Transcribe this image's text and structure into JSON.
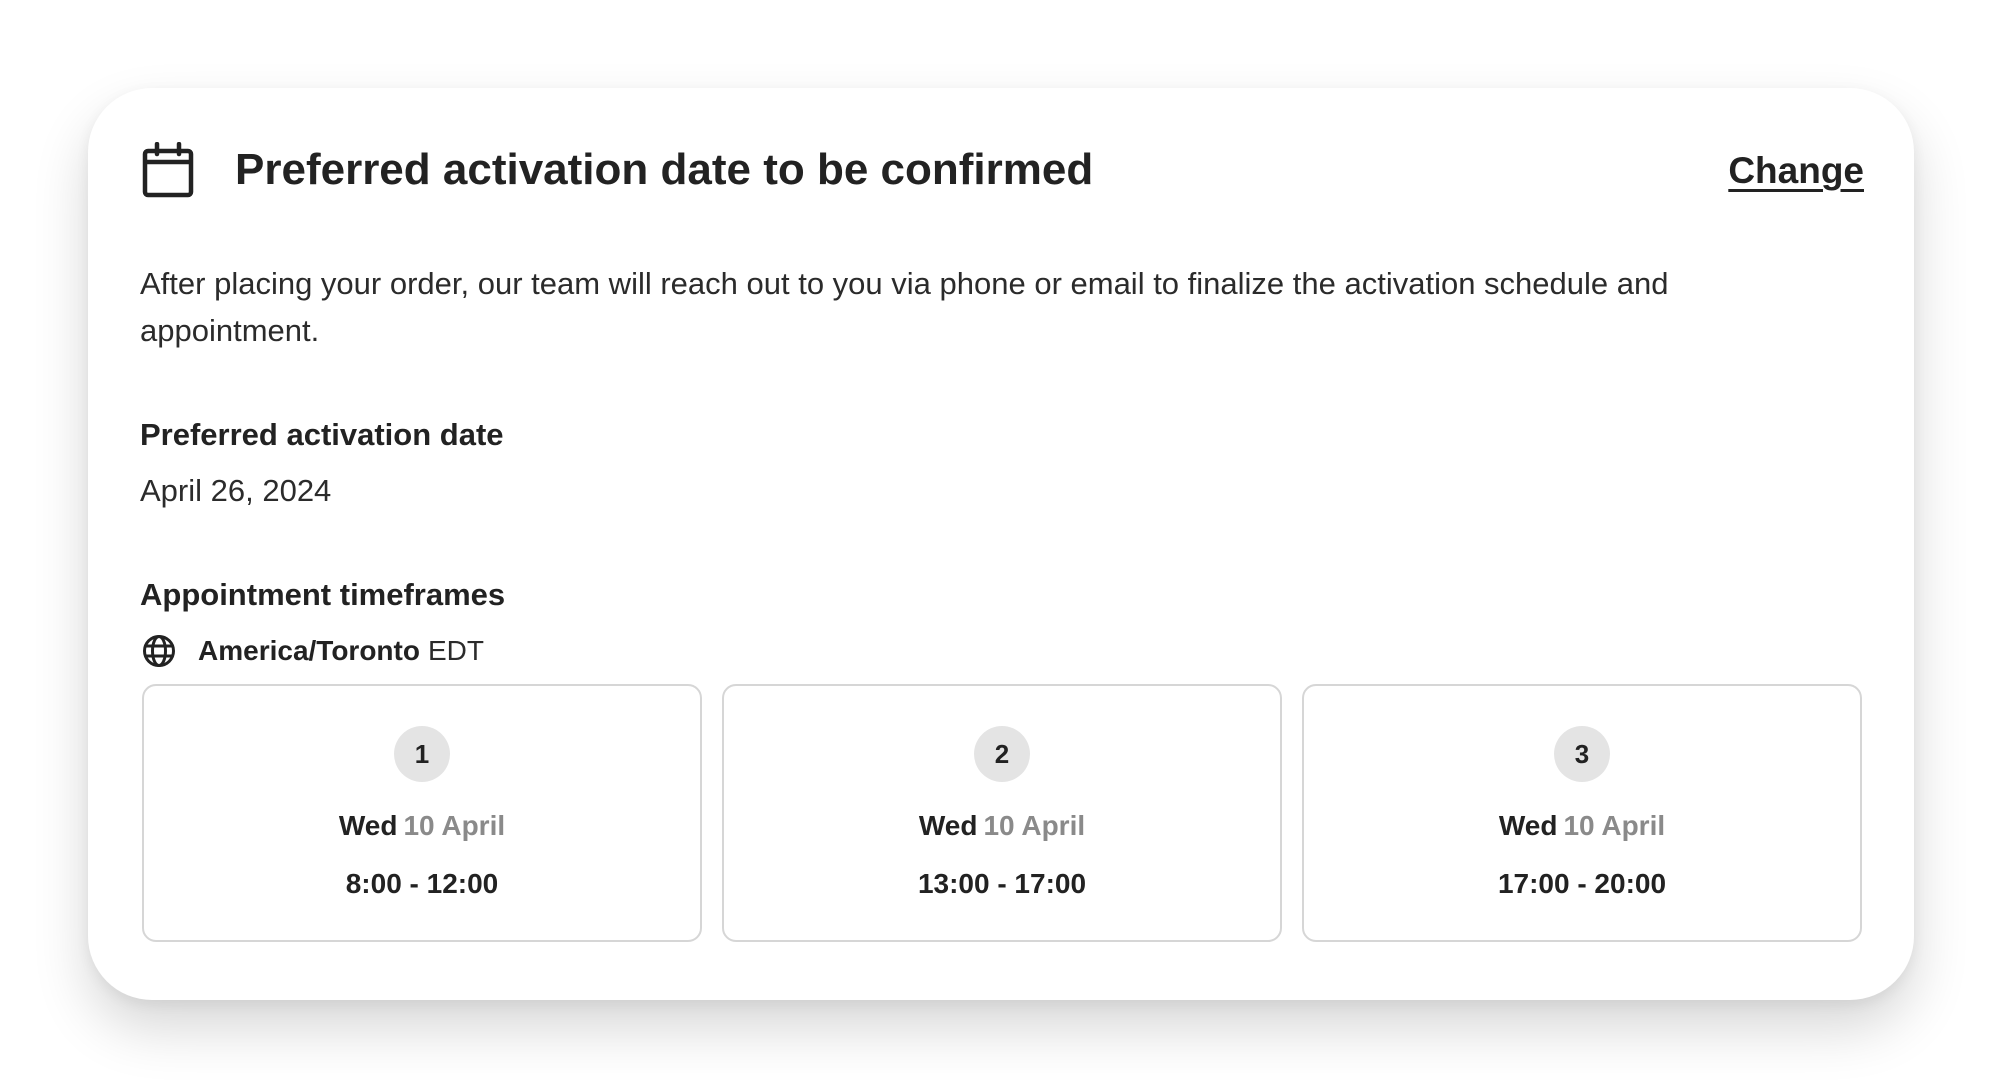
{
  "card": {
    "title": "Preferred activation date to be confirmed",
    "change_label": "Change",
    "calendar_icon": "calendar-icon",
    "description": "After placing your order, our team will reach out to you via phone or email to finalize the activation schedule and appointment."
  },
  "preferred_date": {
    "label": "Preferred activation date",
    "value": "April 26, 2024"
  },
  "appointments": {
    "label": "Appointment timeframes",
    "timezone_icon": "globe-icon",
    "timezone_name": "America/Toronto",
    "timezone_abbr": "EDT",
    "slots": [
      {
        "number": "1",
        "day": "Wed",
        "date": "10 April",
        "time": "8:00 - 12:00"
      },
      {
        "number": "2",
        "day": "Wed",
        "date": "10 April",
        "time": "13:00 - 17:00"
      },
      {
        "number": "3",
        "day": "Wed",
        "date": "10 April",
        "time": "17:00 - 20:00"
      }
    ]
  },
  "colors": {
    "text_primary": "#222222",
    "text_muted": "#8a8a8a",
    "badge_bg": "#e4e4e4",
    "border": "#d6d6d6"
  }
}
